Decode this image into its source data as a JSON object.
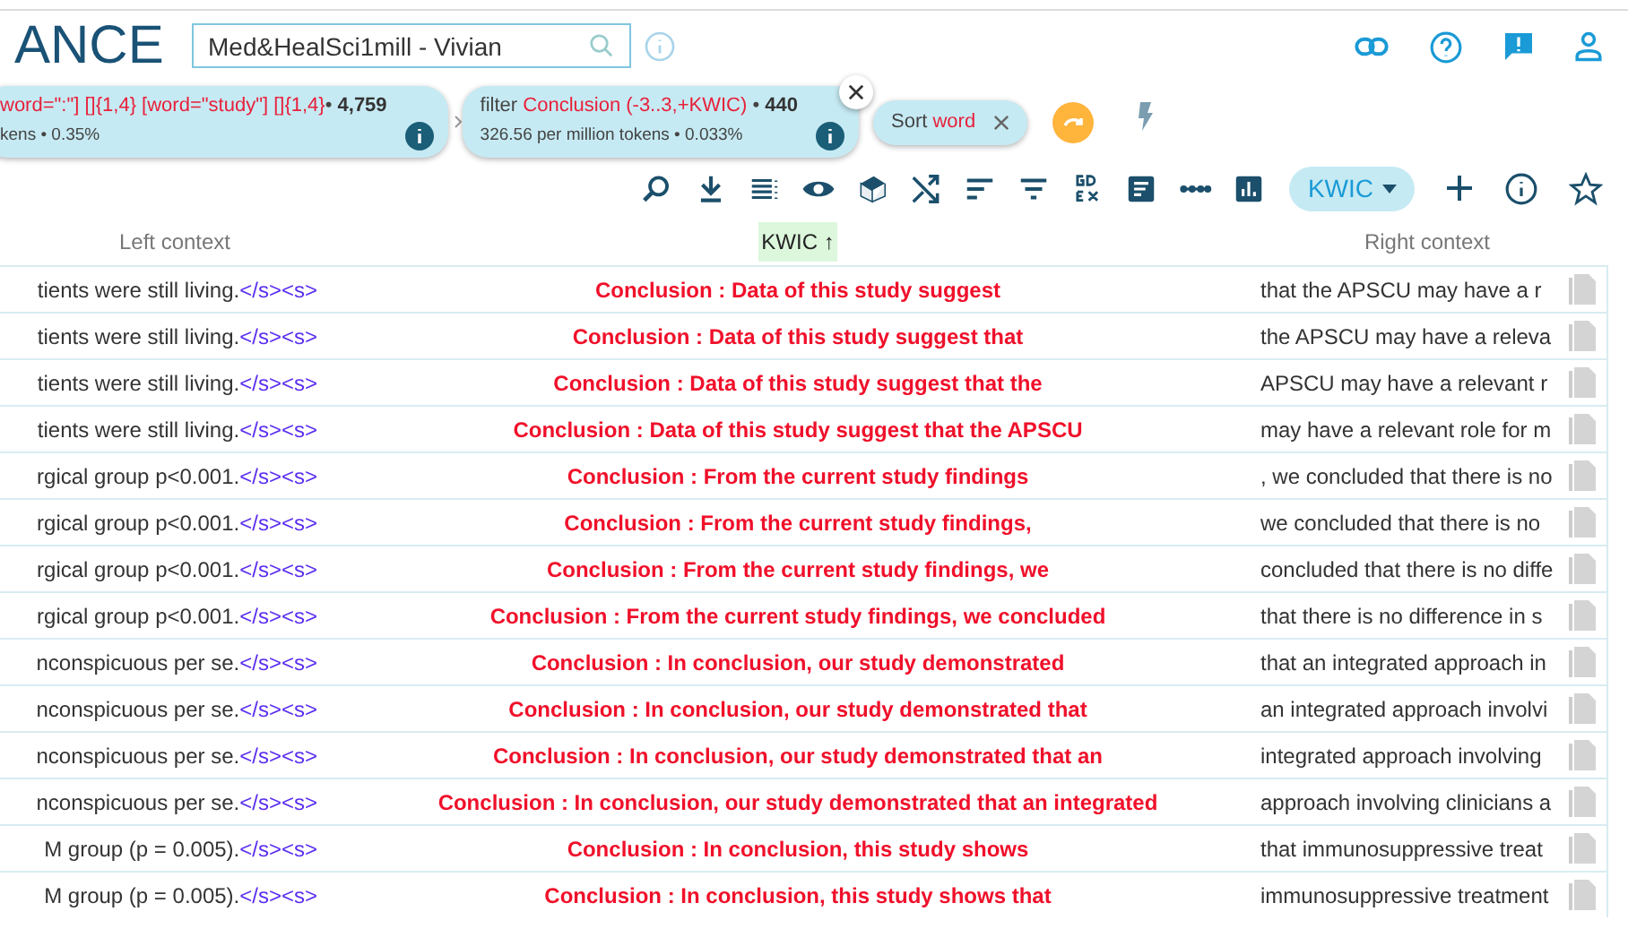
{
  "header": {
    "logo": "ANCE",
    "corpus_field": {
      "value": "Med&HealSci1mill - Vivian"
    }
  },
  "query_chips": [
    {
      "kind": "query",
      "parts": [
        {
          "text": "word=\":\"] []{1,4} [word=\"study\"] []{1,4}",
          "kind": "red"
        },
        {
          "text": "• ",
          "kind": "plain"
        },
        {
          "text": "4,759",
          "kind": "bold"
        }
      ],
      "stats": "kens • 0.35%",
      "closable": false
    },
    {
      "kind": "query",
      "parts": [
        {
          "text": "filter ",
          "kind": "plain"
        },
        {
          "text": "Conclusion (-3..3,+KWIC)",
          "kind": "red"
        },
        {
          "text": " • ",
          "kind": "plain"
        },
        {
          "text": "440",
          "kind": "bold"
        }
      ],
      "stats": "326.56 per million tokens • 0.033%",
      "closable": true
    },
    {
      "kind": "sort",
      "parts": [
        {
          "text": "Sort ",
          "kind": "plain"
        },
        {
          "text": "word",
          "kind": "red"
        }
      ],
      "closable": true
    }
  ],
  "view_dropdown": {
    "label": "KWIC"
  },
  "columns": [
    {
      "label": "Left context",
      "sorted": false
    },
    {
      "label": "KWIC",
      "sorted": true,
      "arrow": "↑"
    },
    {
      "label": "Right context",
      "sorted": false
    }
  ],
  "rows": [
    {
      "left": "tients were still living.",
      "tag": "</s><s>",
      "kwic": "Conclusion : Data of this study suggest",
      "right": "that the APSCU may have a r"
    },
    {
      "left": "tients were still living.",
      "tag": "</s><s>",
      "kwic": "Conclusion : Data of this study suggest that",
      "right": "the APSCU may have a releva"
    },
    {
      "left": "tients were still living.",
      "tag": "</s><s>",
      "kwic": "Conclusion : Data of this study suggest that the",
      "right": "APSCU may have a relevant r"
    },
    {
      "left": "tients were still living.",
      "tag": "</s><s>",
      "kwic": "Conclusion : Data of this study suggest that the APSCU",
      "right": "may have a relevant role for m"
    },
    {
      "left": "rgical group p<0.001.",
      "tag": "</s><s>",
      "kwic": "Conclusion : From the current study findings",
      "right": ", we concluded that there is no"
    },
    {
      "left": "rgical group p<0.001.",
      "tag": "</s><s>",
      "kwic": "Conclusion : From the current study findings,",
      "right": "we concluded that there is no"
    },
    {
      "left": "rgical group p<0.001.",
      "tag": "</s><s>",
      "kwic": "Conclusion : From the current study findings, we",
      "right": "concluded that there is no diffe"
    },
    {
      "left": "rgical group p<0.001.",
      "tag": "</s><s>",
      "kwic": "Conclusion : From the current study findings, we concluded",
      "right": "that there is no difference in s"
    },
    {
      "left": "nconspicuous per se.",
      "tag": "</s><s>",
      "kwic": "Conclusion : In conclusion, our study demonstrated",
      "right": "that an integrated approach in"
    },
    {
      "left": "nconspicuous per se.",
      "tag": "</s><s>",
      "kwic": "Conclusion : In conclusion, our study demonstrated that",
      "right": "an integrated approach involvi"
    },
    {
      "left": "nconspicuous per se.",
      "tag": "</s><s>",
      "kwic": "Conclusion : In conclusion, our study demonstrated that an",
      "right": "integrated approach involving"
    },
    {
      "left": "nconspicuous per se.",
      "tag": "</s><s>",
      "kwic": "Conclusion : In conclusion, our study demonstrated that an integrated",
      "right": "approach involving clinicians a"
    },
    {
      "left": "M group (p = 0.005).",
      "tag": "</s><s>",
      "kwic": "Conclusion : In conclusion, this study shows",
      "right": "that immunosuppressive treat"
    },
    {
      "left": "M group (p = 0.005).",
      "tag": "</s><s>",
      "kwic": "Conclusion : In conclusion, this study shows that",
      "right": "immunosuppressive treatment"
    }
  ]
}
